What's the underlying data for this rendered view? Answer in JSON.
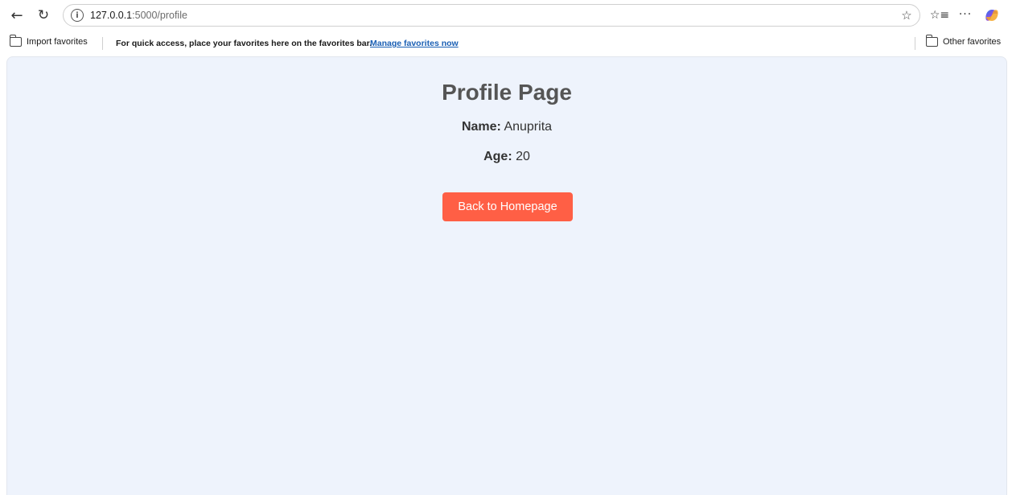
{
  "browser": {
    "url_host": "127.0.0.1",
    "url_path": ":5000/profile",
    "icons": {
      "back": "back-arrow-icon",
      "refresh": "refresh-icon",
      "info": "info-icon",
      "star": "star-icon",
      "favorites": "favorites-list-icon",
      "more": "more-icon",
      "copilot": "copilot-icon"
    }
  },
  "favorites_bar": {
    "import_label": "Import favorites",
    "message": "For quick access, place your favorites here on the favorites bar.",
    "manage_link": "Manage favorites now",
    "other_label": "Other favorites"
  },
  "page": {
    "title": "Profile Page",
    "name_label": "Name:",
    "name_value": "Anuprita",
    "age_label": "Age:",
    "age_value": "20",
    "back_button": "Back to Homepage",
    "colors": {
      "background": "#eef3fc",
      "button": "#ff5f45",
      "title": "#555555"
    }
  }
}
